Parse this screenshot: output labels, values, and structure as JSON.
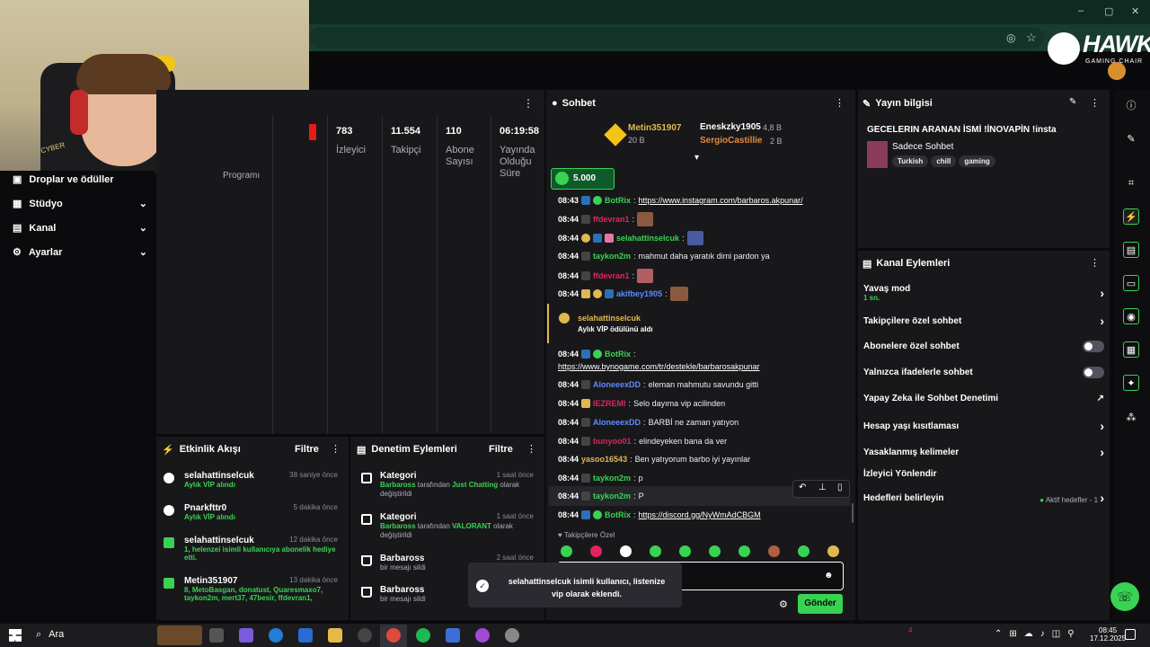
{
  "browser": {
    "window_controls": [
      "–",
      "▢",
      "✕"
    ]
  },
  "brand": {
    "name": "HAWK",
    "sub": "GAMING CHAIR"
  },
  "webcam": {
    "shirt_text": "CYBER"
  },
  "nav": {
    "items": [
      {
        "label": "Droplar ve ödüller"
      },
      {
        "label": "Stüdyo"
      },
      {
        "label": "Kanal"
      },
      {
        "label": "Ayarlar"
      }
    ]
  },
  "stats": {
    "program_label": "Programı",
    "live_badge": "",
    "items": [
      {
        "value": "783",
        "label": "İzleyici"
      },
      {
        "value": "11.554",
        "label": "Takipçi"
      },
      {
        "value": "110",
        "label": "Abone Sayısı"
      },
      {
        "value": "06:19:58",
        "label": "Yayında Olduğu Süre"
      }
    ]
  },
  "activity": {
    "title": "Etkinlik Akışı",
    "filter": "Filtre",
    "items": [
      {
        "name": "selahattinselcuk",
        "time": "38 saniye önce",
        "sub": "Aylık VİP alındı"
      },
      {
        "name": "Pnarkfttr0",
        "time": "5 dakika önce",
        "sub": "Aylık VİP alındı"
      },
      {
        "name": "selahattinselcuk",
        "time": "12 dakika önce",
        "sub": "1, helenzei isimli kullanıcıya abonelik hediye etti."
      },
      {
        "name": "Metin351907",
        "time": "13 dakika önce",
        "sub": "8, MetoBasgan, donatust, Quaresmaxo7, taykon2m, mert37, 47besir, ffdevran1,"
      }
    ]
  },
  "modlog": {
    "title": "Denetim Eylemleri",
    "filter": "Filtre",
    "items": [
      {
        "name": "Kategori",
        "time": "1 saat önce",
        "pre": "Barbaross",
        "mid": " tarafından ",
        "em": "Just Chatting",
        "post": " olarak değiştirildi"
      },
      {
        "name": "Kategori",
        "time": "1 saat önce",
        "pre": "Barbaross",
        "mid": " tarafından ",
        "em": "VALORANT",
        "post": " olarak değiştirildi"
      },
      {
        "name": "Barbaross",
        "time": "2 saat önce",
        "sub": "bir mesajı sildi"
      },
      {
        "name": "Barbaross",
        "time": "",
        "sub": "bir mesajı sildi"
      }
    ]
  },
  "chat": {
    "title": "Sohbet",
    "leaders": [
      {
        "name": "Metin351907",
        "value": "20 B"
      },
      {
        "name": "Eneskzky1905",
        "value": "4,8 B"
      },
      {
        "name": "SergioCastillie",
        "value": "2 B"
      }
    ],
    "points": "5.000",
    "messages": [
      {
        "time": "08:43",
        "user": "BotRix",
        "color": "#39d353",
        "text": "",
        "link": "https://www.instagram.com/barbaros.akpunar/"
      },
      {
        "time": "08:44",
        "user": "ffdevran1",
        "color": "#e0245e",
        "text": "",
        "emote": true
      },
      {
        "time": "08:44",
        "user": "selahattinselcuk",
        "color": "#39d353",
        "text": "",
        "emote": true
      },
      {
        "time": "08:44",
        "user": "taykon2m",
        "color": "#39d353",
        "text": "mahmut daha yaratık dimi pardon ya"
      },
      {
        "time": "08:44",
        "user": "ffdevran1",
        "color": "#e0245e",
        "text": "",
        "emote": true
      },
      {
        "time": "08:44",
        "user": "akifbey1905",
        "color": "#5b8cff",
        "text": "",
        "emote": true
      }
    ],
    "vip_event": {
      "user": "selahattinselcuk",
      "text": "Aylık VİP ödülünü aldı"
    },
    "messages2": [
      {
        "time": "08:44",
        "user": "BotRix",
        "color": "#39d353",
        "text": "",
        "link": ""
      },
      {
        "time": "08:44",
        "user": "AloneeexDD",
        "color": "#5b8cff",
        "text": "eleman mahmutu savundu gitti"
      },
      {
        "time": "08:44",
        "user": "IEZREMI",
        "color": "#e0245e",
        "text": "Selo dayıma vip acilinden"
      },
      {
        "time": "08:44",
        "user": "AloneeexDD",
        "color": "#5b8cff",
        "text": "BARBİ ne zaman yatıyon"
      },
      {
        "time": "08:44",
        "user": "bunyoo01",
        "color": "#e0245e",
        "text": "elindeyeken bana da ver"
      },
      {
        "time": "08:44",
        "user": "yasoo16543",
        "color": "#e0b84f",
        "text": "Ben yatıyorum barbo iyi yayınlar"
      },
      {
        "time": "08:44",
        "user": "taykon2m",
        "color": "#39d353",
        "text": "p"
      },
      {
        "time": "08:44",
        "user": "taykon2m",
        "color": "#39d353",
        "text": "P"
      },
      {
        "time": "08:44",
        "user": "BotRix",
        "color": "#39d353",
        "text": "",
        "link": "https://discord.gg/NyWmAdCBGM"
      }
    ],
    "botrix_link2": "https://www.bynogame.com/tr/destekle/barbarosakpunar",
    "followers_only": "Takipçilere Özel",
    "send": "Gönder",
    "toast": "selahattinselcuk isimli kullanıcı, listenize vip olarak eklendi."
  },
  "info": {
    "title": "Yayın bilgisi",
    "stream_title": "GECELERIN ARANAN İSMİ !İNOVAPİN !insta",
    "category": "Sadece Sohbet",
    "tags": [
      "Turkish",
      "chill",
      "gaming"
    ]
  },
  "actions": {
    "title": "Kanal Eylemleri",
    "slow_mode": "Yavaş mod",
    "slow_value": "1 sn.",
    "rows": [
      {
        "label": "Takipçilere özel sohbet",
        "kind": "chev"
      },
      {
        "label": "Abonelere özel sohbet",
        "kind": "toggle"
      },
      {
        "label": "Yalnızca ifadelerle sohbet",
        "kind": "toggle"
      },
      {
        "label": "Yapay Zeka ile Sohbet Denetimi",
        "kind": "ext"
      },
      {
        "label": "Hesap yaşı kısıtlaması",
        "kind": "chev"
      },
      {
        "label": "Yasaklanmış kelimeler",
        "kind": "chev"
      },
      {
        "label": "İzleyici Yönlendir",
        "kind": ""
      },
      {
        "label": "Hedefleri belirleyin",
        "kind": "goal"
      }
    ],
    "goal_status": "Aktif hedefler - 1"
  },
  "taskbar": {
    "search": "Ara",
    "time": "08:45",
    "date": "17.12.2025",
    "notif": "4"
  }
}
